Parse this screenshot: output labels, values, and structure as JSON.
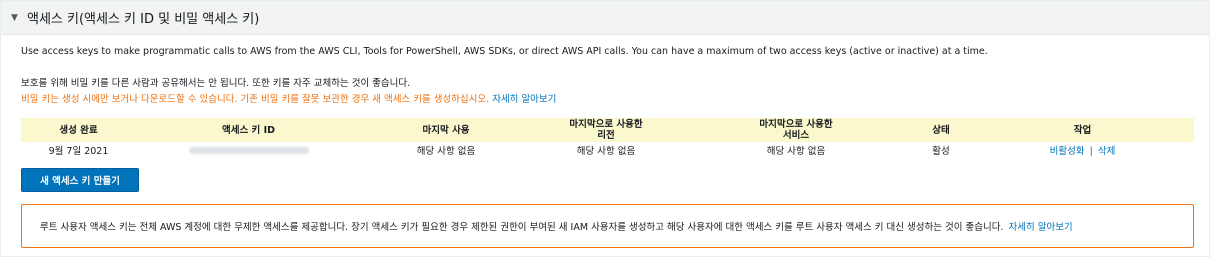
{
  "section": {
    "title": "액세스 키(액세스 키 ID 및 비밀 액세스 키)"
  },
  "description": {
    "line1": "Use access keys to make programmatic calls to AWS from the AWS CLI, Tools for PowerShell, AWS SDKs, or direct AWS API calls. You can have a maximum of two access keys (active or inactive) at a time.",
    "line2": "보호를 위해 비밀 키를 다른 사람과 공유해서는 안 됩니다. 또한 키를 자주 교체하는 것이 좋습니다.",
    "warning": "비밀 키는 생성 시에만 보거나 다운로드할 수 있습니다. 기존 비밀 키를 잘못 보관한 경우 새 액세스 키를 생성하십시오.",
    "learn_more": "자세히 알아보기"
  },
  "table": {
    "headers": {
      "created": "생성 완료",
      "access_key_id": "액세스 키 ID",
      "last_used": "마지막 사용",
      "last_used_region_line1": "마지막으로 사용한",
      "last_used_region_line2": "리전",
      "last_used_service_line1": "마지막으로 사용한",
      "last_used_service_line2": "서비스",
      "status": "상태",
      "actions": "작업"
    },
    "rows": [
      {
        "created": "9월 7일 2021",
        "last_used": "해당 사항 없음",
        "last_used_region": "해당 사항 없음",
        "last_used_service": "해당 사항 없음",
        "status": "활성",
        "action_deactivate": "비활성화",
        "action_separator": "|",
        "action_delete": "삭제"
      }
    ]
  },
  "create_button": {
    "label": "새 액세스 키 만들기"
  },
  "alert": {
    "text": "루트 사용자 액세스 키는 전체 AWS 계정에 대한 무제한 액세스를 제공합니다. 장기 액세스 키가 필요한 경우 제한된 권한이 부여된 새 IAM 사용자를 생성하고 해당 사용자에 대한 액세스 키를 루트 사용자 액세스 키 대신 생성하는 것이 좋습니다.",
    "learn_more": "자세히 알아보기"
  },
  "colors": {
    "link": "#0073bb",
    "warning": "#ec7211",
    "header_bg": "#fbf8cd",
    "button_bg": "#0073bb",
    "section_bg": "#f2f3f3"
  },
  "icons": {
    "caret": "caret-down-icon"
  }
}
